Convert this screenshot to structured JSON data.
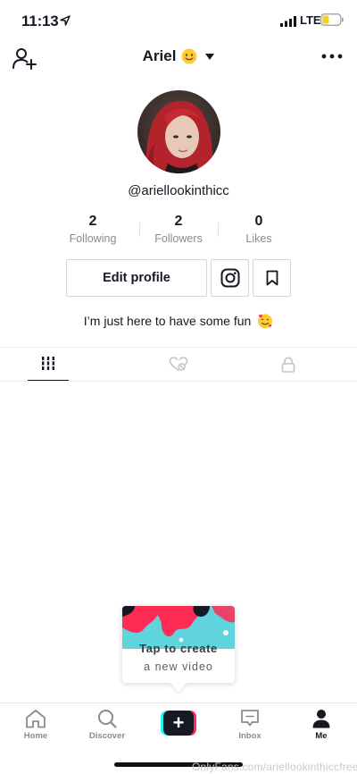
{
  "status_bar": {
    "time": "11:13",
    "network": "LTE",
    "icons": [
      "location-arrow-icon",
      "signal-icon",
      "battery-icon"
    ],
    "battery_color": "#f5d020"
  },
  "header": {
    "title": "Ariel",
    "title_emoji": "smiling-face-emoji",
    "left_icon": "add-user-icon",
    "right_icon": "more-icon",
    "dropdown_icon": "caret-down-icon"
  },
  "profile": {
    "username": "@ariellookinthicc",
    "stats": [
      {
        "value": "2",
        "label": "Following"
      },
      {
        "value": "2",
        "label": "Followers"
      },
      {
        "value": "0",
        "label": "Likes"
      }
    ],
    "edit_button_label": "Edit profile",
    "bio": "I’m just here to have some fun",
    "bio_emoji": "smiling-face-with-hearts-emoji"
  },
  "tabs": [
    {
      "name": "videos",
      "icon": "grid-icon",
      "active": true
    },
    {
      "name": "liked",
      "icon": "liked-heart-icon",
      "active": false
    },
    {
      "name": "private",
      "icon": "lock-icon",
      "active": false
    }
  ],
  "create_tooltip": {
    "line1": "Tap to create",
    "line2": "a new video"
  },
  "bottom_nav": [
    {
      "label": "Home",
      "icon": "home-icon"
    },
    {
      "label": "Discover",
      "icon": "search-icon"
    },
    {
      "label": "",
      "icon": "plus-icon"
    },
    {
      "label": "Inbox",
      "icon": "inbox-icon"
    },
    {
      "label": "Me",
      "icon": "person-icon",
      "active": true
    }
  ],
  "watermark": "OnlyFans.com/ariellookinthiccfree",
  "colors": {
    "text": "#161823",
    "muted": "#8a8b91",
    "accent_cyan": "#25f4ee",
    "accent_red": "#fe2c55"
  }
}
